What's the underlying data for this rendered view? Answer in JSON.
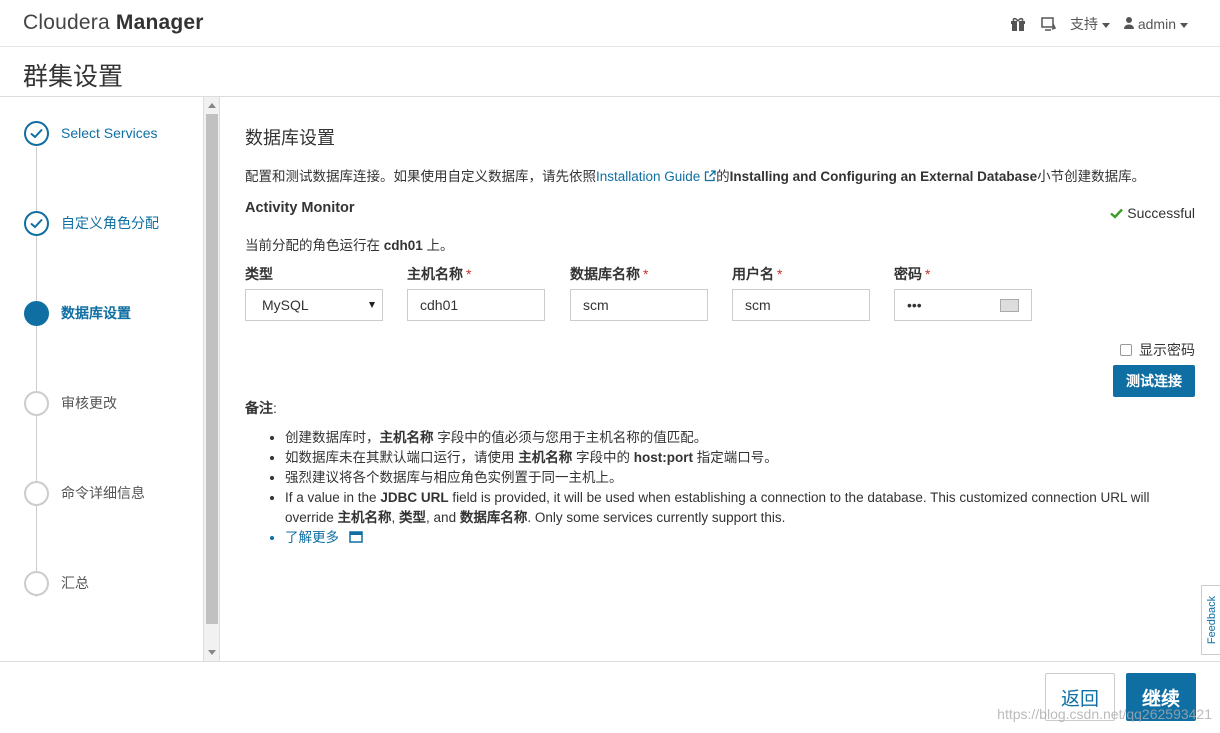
{
  "header": {
    "brand_light": "Cloudera",
    "brand_bold": "Manager",
    "support_label": "支持",
    "user_label": "admin"
  },
  "page": {
    "title": "群集设置"
  },
  "steps": [
    {
      "label": "Select Services",
      "state": "done"
    },
    {
      "label": "自定义角色分配",
      "state": "done"
    },
    {
      "label": "数据库设置",
      "state": "active"
    },
    {
      "label": "审核更改",
      "state": "pending"
    },
    {
      "label": "命令详细信息",
      "state": "pending"
    },
    {
      "label": "汇总",
      "state": "pending"
    }
  ],
  "main": {
    "title": "数据库设置",
    "desc_prefix": "配置和测试数据库连接。如果使用自定义数据库，请先依照",
    "desc_link": "Installation Guide",
    "desc_mid": "的",
    "desc_bold": "Installing and Configuring an External Database",
    "desc_suffix": "小节创建数据库。",
    "section_title": "Activity Monitor",
    "status": "Successful",
    "assigned_prefix": "当前分配的角色运行在 ",
    "assigned_host": "cdh01",
    "assigned_suffix": " 上。",
    "fields": {
      "type": {
        "label": "类型",
        "value": "MySQL"
      },
      "host": {
        "label": "主机名称",
        "value": "cdh01"
      },
      "dbname": {
        "label": "数据库名称",
        "value": "scm"
      },
      "user": {
        "label": "用户名",
        "value": "scm"
      },
      "password": {
        "label": "密码",
        "value": "•••"
      }
    },
    "required_mark": "*",
    "show_password": "显示密码",
    "test_button": "测试连接",
    "notes_title": "备注",
    "notes_colon": ":",
    "note1_a": "创建数据库时，",
    "note1_b": "主机名称",
    "note1_c": " 字段中的值必须与您用于主机名称的值匹配。",
    "note2_a": "如数据库未在其默认端口运行，请使用 ",
    "note2_b": "主机名称",
    "note2_c": " 字段中的 ",
    "note2_d": "host:port",
    "note2_e": " 指定端口号。",
    "note3": "强烈建议将各个数据库与相应角色实例置于同一主机上。",
    "note4_a": "If a value in the ",
    "note4_b": "JDBC URL",
    "note4_c": " field is provided, it will be used when establishing a connection to the database. This customized connection URL will override ",
    "note4_d": "主机名称",
    "note4_e": ", ",
    "note4_f": "类型",
    "note4_g": ", and ",
    "note4_h": "数据库名称",
    "note4_i": ". Only some services currently support this.",
    "learn_more": "了解更多"
  },
  "footer": {
    "back_button": "返回",
    "continue_button": "继续",
    "feedback": "Feedback",
    "watermark": "https://blog.csdn.net/qq262593421"
  },
  "colors": {
    "accent": "#0f6fa3",
    "success": "#3a9d23",
    "required": "#c9302c"
  }
}
